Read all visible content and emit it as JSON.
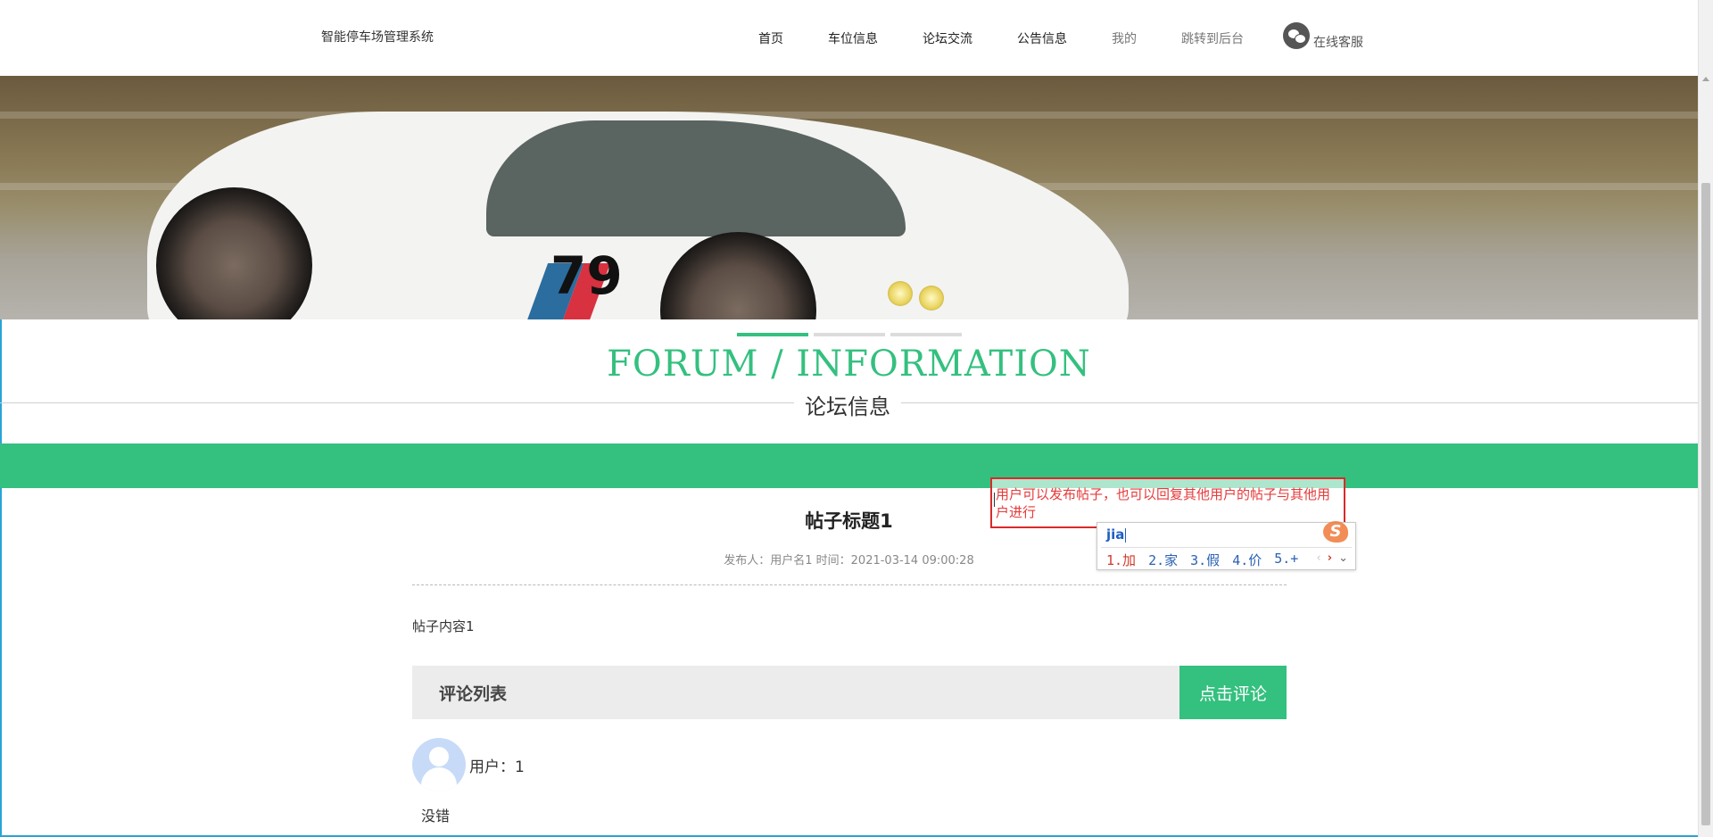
{
  "header": {
    "site_title": "智能停车场管理系统",
    "nav": [
      {
        "label": "首页"
      },
      {
        "label": "车位信息"
      },
      {
        "label": "论坛交流"
      },
      {
        "label": "公告信息"
      },
      {
        "label": "我的"
      },
      {
        "label": "跳转到后台"
      }
    ],
    "service_label": "在线客服",
    "service_icon": "wechat-icon"
  },
  "banner": {
    "car_number": "79"
  },
  "section": {
    "title_en": "FORUM / INFORMATION",
    "title_cn": "论坛信息"
  },
  "post": {
    "title": "帖子标题1",
    "meta": "发布人：用户名1 时间：2021-03-14 09:00:28",
    "content": "帖子内容1"
  },
  "comments": {
    "heading": "评论列表",
    "add_button": "点击评论",
    "items": [
      {
        "user": "用户：1",
        "text": "没错"
      }
    ]
  },
  "annotation": {
    "text": "用户可以发布帖子，也可以回复其他用户的帖子与其他用户进行"
  },
  "ime": {
    "input": "jia",
    "candidates": [
      "1.加",
      "2.家",
      "3.假",
      "4.价",
      "5.+"
    ],
    "logo": "S"
  },
  "colors": {
    "accent": "#34c07f",
    "annotation": "#d92a2a",
    "ime_candidate": "#2a62b3"
  }
}
